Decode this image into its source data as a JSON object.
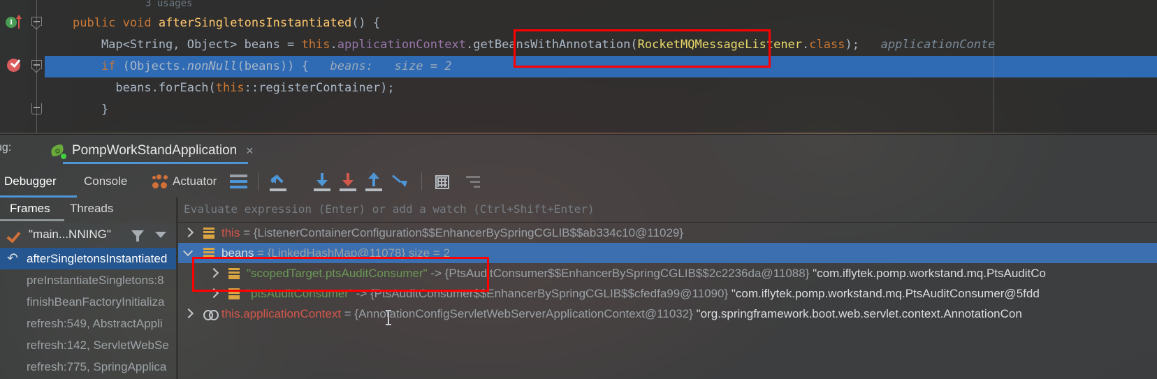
{
  "editor": {
    "usages_hint": "3 usages",
    "lines": [
      {
        "id": "l1",
        "segments": [
          {
            "t": "public ",
            "c": "kw"
          },
          {
            "t": "void ",
            "c": "kw"
          },
          {
            "t": "afterSingletonsInstantiated",
            "c": "fn"
          },
          {
            "t": "() {",
            "c": "plain"
          }
        ]
      },
      {
        "id": "l2",
        "segments": [
          {
            "t": "    Map<String, Object> beans = ",
            "c": "plain"
          },
          {
            "t": "this",
            "c": "kw"
          },
          {
            "t": ".",
            "c": "plain"
          },
          {
            "t": "applicationContext",
            "c": "fld"
          },
          {
            "t": ".",
            "c": "plain"
          },
          {
            "t": "getBeansWithAnnotation",
            "c": "plain"
          },
          {
            "t": "(",
            "c": "plain"
          },
          {
            "t": "RocketMQMessageListener",
            "c": "anncls"
          },
          {
            "t": ".",
            "c": "plain"
          },
          {
            "t": "class",
            "c": "kw"
          },
          {
            "t": ");",
            "c": "plain"
          },
          {
            "t": "   applicationConte",
            "c": "hint"
          }
        ]
      },
      {
        "id": "l3",
        "segments": [
          {
            "t": "    ",
            "c": "plain"
          },
          {
            "t": "if ",
            "c": "kw"
          },
          {
            "t": "(Objects.",
            "c": "plain"
          },
          {
            "t": "nonNull",
            "c": "ital"
          },
          {
            "t": "(beans)) {",
            "c": "plain"
          },
          {
            "t": "   beans:   size = 2",
            "c": "hint2"
          }
        ]
      },
      {
        "id": "l4",
        "segments": [
          {
            "t": "      beans.forEach(",
            "c": "plain"
          },
          {
            "t": "this",
            "c": "kw"
          },
          {
            "t": "::registerContainer);",
            "c": "plain"
          }
        ]
      },
      {
        "id": "l5",
        "segments": [
          {
            "t": "    }",
            "c": "plain"
          }
        ]
      }
    ],
    "highlighted_line_index": 2
  },
  "annotations": [
    {
      "name": "code-highlight-box",
      "color": "#ff0000"
    },
    {
      "name": "variables-highlight-box",
      "color": "#ff0000"
    }
  ],
  "debug_panel": {
    "label": "ug:",
    "run_tab": {
      "name": "PompWorkStandApplication",
      "close": "×",
      "icon": "spring-boot-icon"
    },
    "tabs": [
      {
        "id": "tab-debugger",
        "label": "Debugger",
        "active": true
      },
      {
        "id": "tab-console",
        "label": "Console",
        "active": false
      },
      {
        "id": "tab-actuator",
        "label": "Actuator",
        "active": false
      }
    ],
    "toolbar_icons": [
      "layout-settings-icon",
      "step-over-icon",
      "step-into-icon",
      "force-step-into-icon",
      "step-out-icon",
      "run-to-cursor-icon",
      "evaluate-expression-icon",
      "mute-breakpoints-icon"
    ],
    "frames": {
      "tabs": [
        {
          "id": "ft-frames",
          "label": "Frames",
          "active": true
        },
        {
          "id": "ft-threads",
          "label": "Threads",
          "active": false
        }
      ],
      "thread": {
        "name": "\"main...NNING\"",
        "icon": "running-check-icon"
      },
      "items": [
        {
          "label": "afterSingletonsInstantiated",
          "selected": true,
          "icon": "return-arrow-icon"
        },
        {
          "label": "preInstantiateSingletons:8",
          "selected": false,
          "icon": ""
        },
        {
          "label": "finishBeanFactoryInitializa",
          "selected": false,
          "icon": ""
        },
        {
          "label": "refresh:549, AbstractAppli",
          "selected": false,
          "icon": ""
        },
        {
          "label": "refresh:142, ServletWebSe",
          "selected": false,
          "icon": ""
        },
        {
          "label": "refresh:775, SpringApplica",
          "selected": false,
          "icon": ""
        }
      ]
    },
    "evaluate_placeholder": "Evaluate expression (Enter) or add a watch (Ctrl+Shift+Enter)",
    "variables": [
      {
        "indent": 0,
        "expanded": false,
        "icon": "stack-frame-icon",
        "name": "this",
        "name_color": "red",
        "selected": false,
        "eq": " = ",
        "value": "{ListenerContainerConfiguration$$EnhancerBySpringCGLIB$$ab334c10@11029}",
        "extra": ""
      },
      {
        "indent": 0,
        "expanded": true,
        "icon": "stack-frame-icon",
        "name": "beans",
        "name_color": "white",
        "selected": true,
        "eq": " = ",
        "value": "{LinkedHashMap@11078}  size = 2",
        "extra": ""
      },
      {
        "indent": 1,
        "expanded": false,
        "icon": "stack-frame-icon",
        "name": "\"scopedTarget.ptsAuditConsumer\"",
        "name_color": "green",
        "selected": false,
        "eq": " -> ",
        "value": "{PtsAuditConsumer$$EnhancerBySpringCGLIB$$2c2236da@11088}",
        "extra": " \"com.iflytek.pomp.workstand.mq.PtsAuditCo"
      },
      {
        "indent": 1,
        "expanded": false,
        "icon": "stack-frame-icon",
        "name": "\"ptsAuditConsumer\"",
        "name_color": "green",
        "selected": false,
        "eq": " -> ",
        "value": "{PtsAuditConsumer$$EnhancerBySpringCGLIB$$cfedfa99@11090}",
        "extra": " \"com.iflytek.pomp.workstand.mq.PtsAuditConsumer@5fdd"
      },
      {
        "indent": 0,
        "expanded": false,
        "icon": "chain-icon",
        "name": "this.applicationContext",
        "name_color": "red",
        "selected": false,
        "eq": " = ",
        "value": "{AnnotationConfigServletWebServerApplicationContext@11032}",
        "extra": " \"org.springframework.boot.web.servlet.context.AnnotationCon"
      }
    ]
  },
  "colors": {
    "accent": "#4e96d6",
    "selection": "#2f6ab5",
    "annotation": "#ff0000",
    "keyword": "#cc7832",
    "method": "#ffc66d",
    "field": "#9876aa",
    "string": "#6a9955"
  }
}
